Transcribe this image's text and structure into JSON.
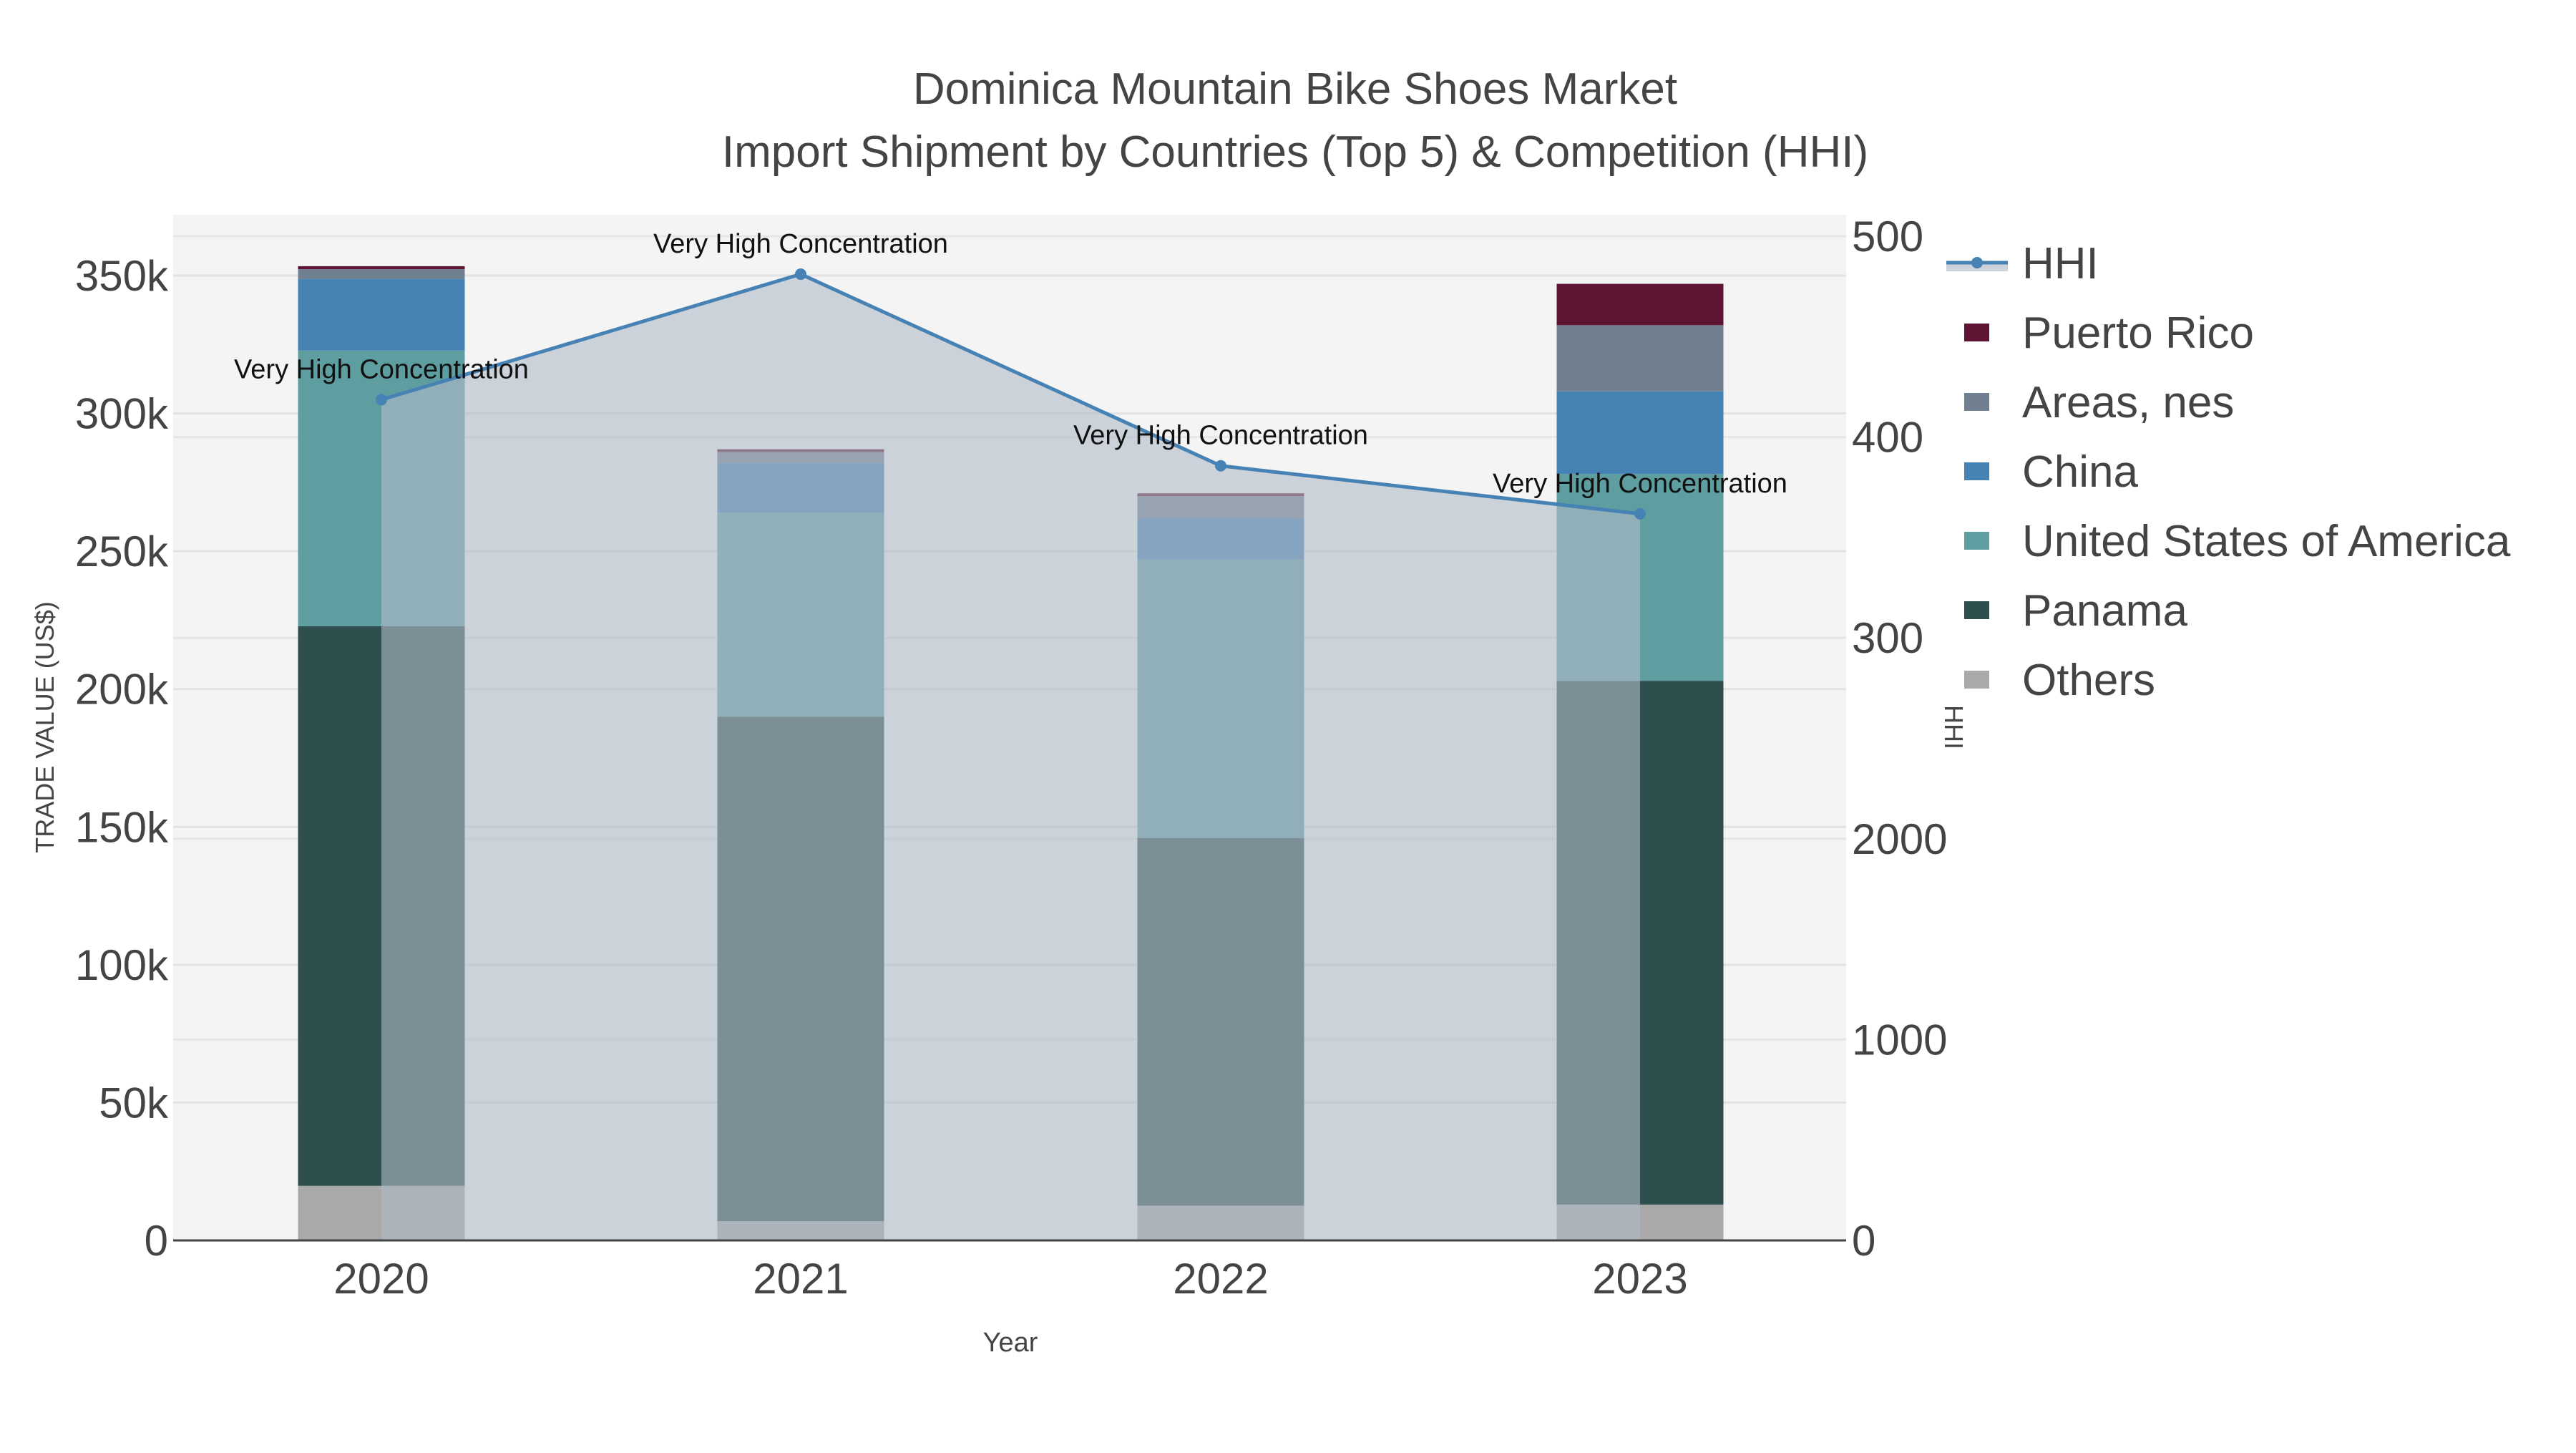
{
  "chart_data": {
    "type": "bar",
    "title": "Dominica Mountain Bike Shoes Market",
    "subtitle": "Import Shipment by Countries (Top 5) & Competition (HHI)",
    "xlabel": "Year",
    "ylabel": "TRADE VALUE (US$)",
    "y2label": "HHI",
    "categories": [
      "2020",
      "2021",
      "2022",
      "2023"
    ],
    "ylim": [
      0,
      370000
    ],
    "y2lim": [
      0,
      5280
    ],
    "yticks": [
      0,
      50000,
      100000,
      150000,
      200000,
      250000,
      300000,
      350000
    ],
    "ytick_labels": [
      "0",
      "50k",
      "100k",
      "150k",
      "200k",
      "250k",
      "300k",
      "350k"
    ],
    "y2ticks": [
      0,
      1000,
      2000,
      3000,
      4000,
      5000
    ],
    "y2tick_labels": [
      "0",
      "1000",
      "2000",
      "300",
      "400",
      "500"
    ],
    "series": [
      {
        "name": "Others",
        "color": "#a9a9a9",
        "values": [
          19800,
          7000,
          12600,
          13000
        ]
      },
      {
        "name": "Panama",
        "color": "#2f4f4f",
        "values": [
          203000,
          183000,
          133400,
          190000
        ]
      },
      {
        "name": "United States of America",
        "color": "#5f9ea0",
        "values": [
          100000,
          74000,
          101000,
          75000
        ]
      },
      {
        "name": "China",
        "color": "#4682b4",
        "values": [
          26000,
          18000,
          15000,
          30000
        ]
      },
      {
        "name": "Areas, nes",
        "color": "#708090",
        "values": [
          3500,
          4000,
          8000,
          24000
        ]
      },
      {
        "name": "Puerto Rico",
        "color": "#5f1434",
        "values": [
          1100,
          1000,
          1000,
          15000
        ]
      }
    ],
    "line": {
      "name": "HHI",
      "color": "#4682b4",
      "values": [
        4186,
        4811,
        3857,
        3618
      ],
      "annotations": [
        "Very High Concentration",
        "Very High Concentration",
        "Very High Concentration",
        "Very High Concentration"
      ]
    },
    "legend_order": [
      "HHI",
      "Puerto Rico",
      "Areas, nes",
      "China",
      "United States of America",
      "Panama",
      "Others"
    ],
    "legend_position": "right",
    "grid": true
  }
}
